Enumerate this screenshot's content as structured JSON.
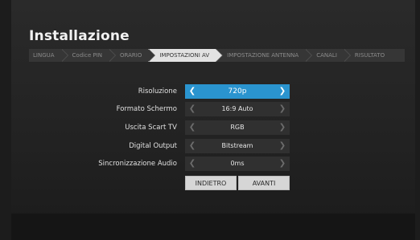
{
  "title": "Installazione",
  "steps": [
    {
      "label": "LINGUA"
    },
    {
      "label": "Codice PIN"
    },
    {
      "label": "ORARIO"
    },
    {
      "label": "IMPOSTAZIONI AV"
    },
    {
      "label": "IMPOSTAZIONE ANTENNA"
    },
    {
      "label": "CANALI"
    },
    {
      "label": "RISULTATO"
    }
  ],
  "active_step": "IMPOSTAZIONI AV",
  "settings": [
    {
      "label": "Risoluzione",
      "value": "720p"
    },
    {
      "label": "Formato Schermo",
      "value": "16:9 Auto"
    },
    {
      "label": "Uscita Scart TV",
      "value": "RGB"
    },
    {
      "label": "Digital Output",
      "value": "Bitstream"
    },
    {
      "label": "Sincronizzazione Audio",
      "value": "0ms"
    }
  ],
  "focused_setting": "Risoluzione",
  "buttons": {
    "back": "INDIETRO",
    "next": "AVANTI"
  },
  "icons": {
    "left": "chevron-left-icon",
    "right": "chevron-right-icon"
  },
  "colors": {
    "accent": "#2a94cf",
    "active_step_bg": "#e2e2e2",
    "background": "#222222"
  }
}
